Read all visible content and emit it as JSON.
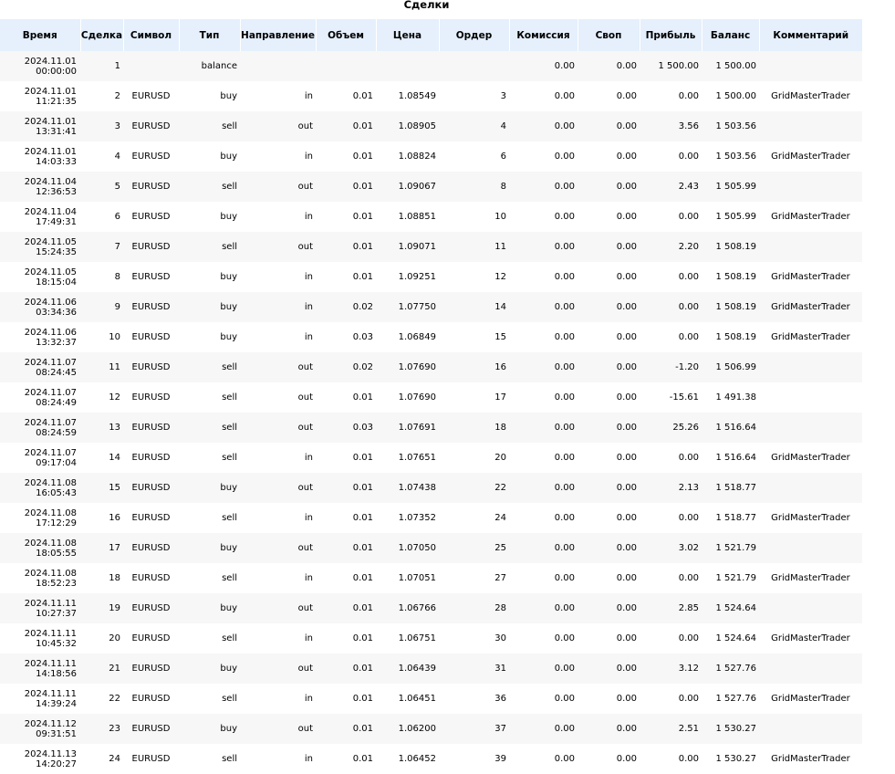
{
  "title": "Сделки",
  "columns": [
    "Время",
    "Сделка",
    "Символ",
    "Тип",
    "Направление",
    "Объем",
    "Цена",
    "Ордер",
    "Комиссия",
    "Своп",
    "Прибыль",
    "Баланс",
    "Комментарий"
  ],
  "rows": [
    {
      "date": "2024.11.01",
      "time": "00:00:00",
      "deal": "1",
      "symbol": "",
      "type": "balance",
      "direction": "",
      "volume": "",
      "price": "",
      "order": "",
      "commission": "0.00",
      "swap": "0.00",
      "profit": "1 500.00",
      "balance": "1 500.00",
      "comment": ""
    },
    {
      "date": "2024.11.01",
      "time": "11:21:35",
      "deal": "2",
      "symbol": "EURUSD",
      "type": "buy",
      "direction": "in",
      "volume": "0.01",
      "price": "1.08549",
      "order": "3",
      "commission": "0.00",
      "swap": "0.00",
      "profit": "0.00",
      "balance": "1 500.00",
      "comment": "GridMasterTrader"
    },
    {
      "date": "2024.11.01",
      "time": "13:31:41",
      "deal": "3",
      "symbol": "EURUSD",
      "type": "sell",
      "direction": "out",
      "volume": "0.01",
      "price": "1.08905",
      "order": "4",
      "commission": "0.00",
      "swap": "0.00",
      "profit": "3.56",
      "balance": "1 503.56",
      "comment": ""
    },
    {
      "date": "2024.11.01",
      "time": "14:03:33",
      "deal": "4",
      "symbol": "EURUSD",
      "type": "buy",
      "direction": "in",
      "volume": "0.01",
      "price": "1.08824",
      "order": "6",
      "commission": "0.00",
      "swap": "0.00",
      "profit": "0.00",
      "balance": "1 503.56",
      "comment": "GridMasterTrader"
    },
    {
      "date": "2024.11.04",
      "time": "12:36:53",
      "deal": "5",
      "symbol": "EURUSD",
      "type": "sell",
      "direction": "out",
      "volume": "0.01",
      "price": "1.09067",
      "order": "8",
      "commission": "0.00",
      "swap": "0.00",
      "profit": "2.43",
      "balance": "1 505.99",
      "comment": ""
    },
    {
      "date": "2024.11.04",
      "time": "17:49:31",
      "deal": "6",
      "symbol": "EURUSD",
      "type": "buy",
      "direction": "in",
      "volume": "0.01",
      "price": "1.08851",
      "order": "10",
      "commission": "0.00",
      "swap": "0.00",
      "profit": "0.00",
      "balance": "1 505.99",
      "comment": "GridMasterTrader"
    },
    {
      "date": "2024.11.05",
      "time": "15:24:35",
      "deal": "7",
      "symbol": "EURUSD",
      "type": "sell",
      "direction": "out",
      "volume": "0.01",
      "price": "1.09071",
      "order": "11",
      "commission": "0.00",
      "swap": "0.00",
      "profit": "2.20",
      "balance": "1 508.19",
      "comment": ""
    },
    {
      "date": "2024.11.05",
      "time": "18:15:04",
      "deal": "8",
      "symbol": "EURUSD",
      "type": "buy",
      "direction": "in",
      "volume": "0.01",
      "price": "1.09251",
      "order": "12",
      "commission": "0.00",
      "swap": "0.00",
      "profit": "0.00",
      "balance": "1 508.19",
      "comment": "GridMasterTrader"
    },
    {
      "date": "2024.11.06",
      "time": "03:34:36",
      "deal": "9",
      "symbol": "EURUSD",
      "type": "buy",
      "direction": "in",
      "volume": "0.02",
      "price": "1.07750",
      "order": "14",
      "commission": "0.00",
      "swap": "0.00",
      "profit": "0.00",
      "balance": "1 508.19",
      "comment": "GridMasterTrader"
    },
    {
      "date": "2024.11.06",
      "time": "13:32:37",
      "deal": "10",
      "symbol": "EURUSD",
      "type": "buy",
      "direction": "in",
      "volume": "0.03",
      "price": "1.06849",
      "order": "15",
      "commission": "0.00",
      "swap": "0.00",
      "profit": "0.00",
      "balance": "1 508.19",
      "comment": "GridMasterTrader"
    },
    {
      "date": "2024.11.07",
      "time": "08:24:45",
      "deal": "11",
      "symbol": "EURUSD",
      "type": "sell",
      "direction": "out",
      "volume": "0.02",
      "price": "1.07690",
      "order": "16",
      "commission": "0.00",
      "swap": "0.00",
      "profit": "-1.20",
      "balance": "1 506.99",
      "comment": ""
    },
    {
      "date": "2024.11.07",
      "time": "08:24:49",
      "deal": "12",
      "symbol": "EURUSD",
      "type": "sell",
      "direction": "out",
      "volume": "0.01",
      "price": "1.07690",
      "order": "17",
      "commission": "0.00",
      "swap": "0.00",
      "profit": "-15.61",
      "balance": "1 491.38",
      "comment": ""
    },
    {
      "date": "2024.11.07",
      "time": "08:24:59",
      "deal": "13",
      "symbol": "EURUSD",
      "type": "sell",
      "direction": "out",
      "volume": "0.03",
      "price": "1.07691",
      "order": "18",
      "commission": "0.00",
      "swap": "0.00",
      "profit": "25.26",
      "balance": "1 516.64",
      "comment": ""
    },
    {
      "date": "2024.11.07",
      "time": "09:17:04",
      "deal": "14",
      "symbol": "EURUSD",
      "type": "sell",
      "direction": "in",
      "volume": "0.01",
      "price": "1.07651",
      "order": "20",
      "commission": "0.00",
      "swap": "0.00",
      "profit": "0.00",
      "balance": "1 516.64",
      "comment": "GridMasterTrader"
    },
    {
      "date": "2024.11.08",
      "time": "16:05:43",
      "deal": "15",
      "symbol": "EURUSD",
      "type": "buy",
      "direction": "out",
      "volume": "0.01",
      "price": "1.07438",
      "order": "22",
      "commission": "0.00",
      "swap": "0.00",
      "profit": "2.13",
      "balance": "1 518.77",
      "comment": ""
    },
    {
      "date": "2024.11.08",
      "time": "17:12:29",
      "deal": "16",
      "symbol": "EURUSD",
      "type": "sell",
      "direction": "in",
      "volume": "0.01",
      "price": "1.07352",
      "order": "24",
      "commission": "0.00",
      "swap": "0.00",
      "profit": "0.00",
      "balance": "1 518.77",
      "comment": "GridMasterTrader"
    },
    {
      "date": "2024.11.08",
      "time": "18:05:55",
      "deal": "17",
      "symbol": "EURUSD",
      "type": "buy",
      "direction": "out",
      "volume": "0.01",
      "price": "1.07050",
      "order": "25",
      "commission": "0.00",
      "swap": "0.00",
      "profit": "3.02",
      "balance": "1 521.79",
      "comment": ""
    },
    {
      "date": "2024.11.08",
      "time": "18:52:23",
      "deal": "18",
      "symbol": "EURUSD",
      "type": "sell",
      "direction": "in",
      "volume": "0.01",
      "price": "1.07051",
      "order": "27",
      "commission": "0.00",
      "swap": "0.00",
      "profit": "0.00",
      "balance": "1 521.79",
      "comment": "GridMasterTrader"
    },
    {
      "date": "2024.11.11",
      "time": "10:27:37",
      "deal": "19",
      "symbol": "EURUSD",
      "type": "buy",
      "direction": "out",
      "volume": "0.01",
      "price": "1.06766",
      "order": "28",
      "commission": "0.00",
      "swap": "0.00",
      "profit": "2.85",
      "balance": "1 524.64",
      "comment": ""
    },
    {
      "date": "2024.11.11",
      "time": "10:45:32",
      "deal": "20",
      "symbol": "EURUSD",
      "type": "sell",
      "direction": "in",
      "volume": "0.01",
      "price": "1.06751",
      "order": "30",
      "commission": "0.00",
      "swap": "0.00",
      "profit": "0.00",
      "balance": "1 524.64",
      "comment": "GridMasterTrader"
    },
    {
      "date": "2024.11.11",
      "time": "14:18:56",
      "deal": "21",
      "symbol": "EURUSD",
      "type": "buy",
      "direction": "out",
      "volume": "0.01",
      "price": "1.06439",
      "order": "31",
      "commission": "0.00",
      "swap": "0.00",
      "profit": "3.12",
      "balance": "1 527.76",
      "comment": ""
    },
    {
      "date": "2024.11.11",
      "time": "14:39:24",
      "deal": "22",
      "symbol": "EURUSD",
      "type": "sell",
      "direction": "in",
      "volume": "0.01",
      "price": "1.06451",
      "order": "36",
      "commission": "0.00",
      "swap": "0.00",
      "profit": "0.00",
      "balance": "1 527.76",
      "comment": "GridMasterTrader"
    },
    {
      "date": "2024.11.12",
      "time": "09:31:51",
      "deal": "23",
      "symbol": "EURUSD",
      "type": "buy",
      "direction": "out",
      "volume": "0.01",
      "price": "1.06200",
      "order": "37",
      "commission": "0.00",
      "swap": "0.00",
      "profit": "2.51",
      "balance": "1 530.27",
      "comment": ""
    },
    {
      "date": "2024.11.13",
      "time": "14:20:27",
      "deal": "24",
      "symbol": "EURUSD",
      "type": "sell",
      "direction": "in",
      "volume": "0.01",
      "price": "1.06452",
      "order": "39",
      "commission": "0.00",
      "swap": "0.00",
      "profit": "0.00",
      "balance": "1 530.27",
      "comment": "GridMasterTrader"
    }
  ]
}
